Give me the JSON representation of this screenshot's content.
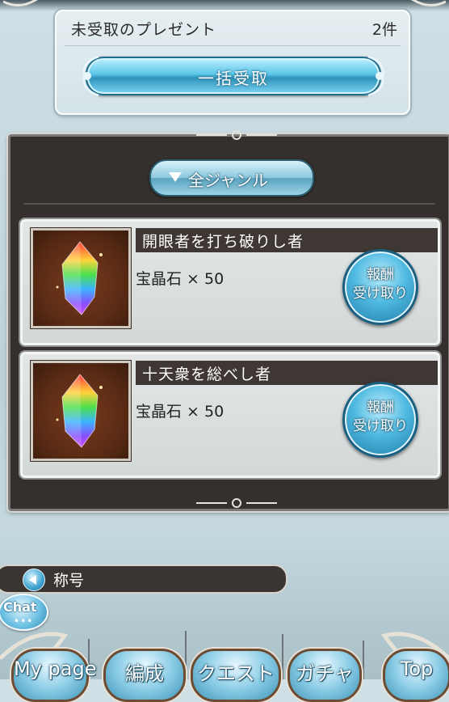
{
  "present": {
    "label": "未受取のプレゼント",
    "count": "2件",
    "bulk_receive_label": "一括受取"
  },
  "filter": {
    "genre_label": "全ジャンル"
  },
  "items": [
    {
      "title": "開眼者を打ち破りし者",
      "reward": "宝晶石 × 50",
      "claim_label_1": "報酬",
      "claim_label_2": "受け取り",
      "icon": "rainbow-crystal-icon"
    },
    {
      "title": "十天衆を総べし者",
      "reward": "宝晶石 × 50",
      "claim_label_1": "報酬",
      "claim_label_2": "受け取り",
      "icon": "rainbow-crystal-icon"
    }
  ],
  "title_section": {
    "label": "称号"
  },
  "chat": {
    "label": "Chat",
    "dots": "•••"
  },
  "nav": {
    "items": [
      "My page",
      "編成",
      "クエスト",
      "ガチャ",
      "Top"
    ]
  },
  "colors": {
    "accent_blue": "#4fb9e0",
    "panel_dark": "#35302d",
    "title_bar": "#3e3733"
  }
}
